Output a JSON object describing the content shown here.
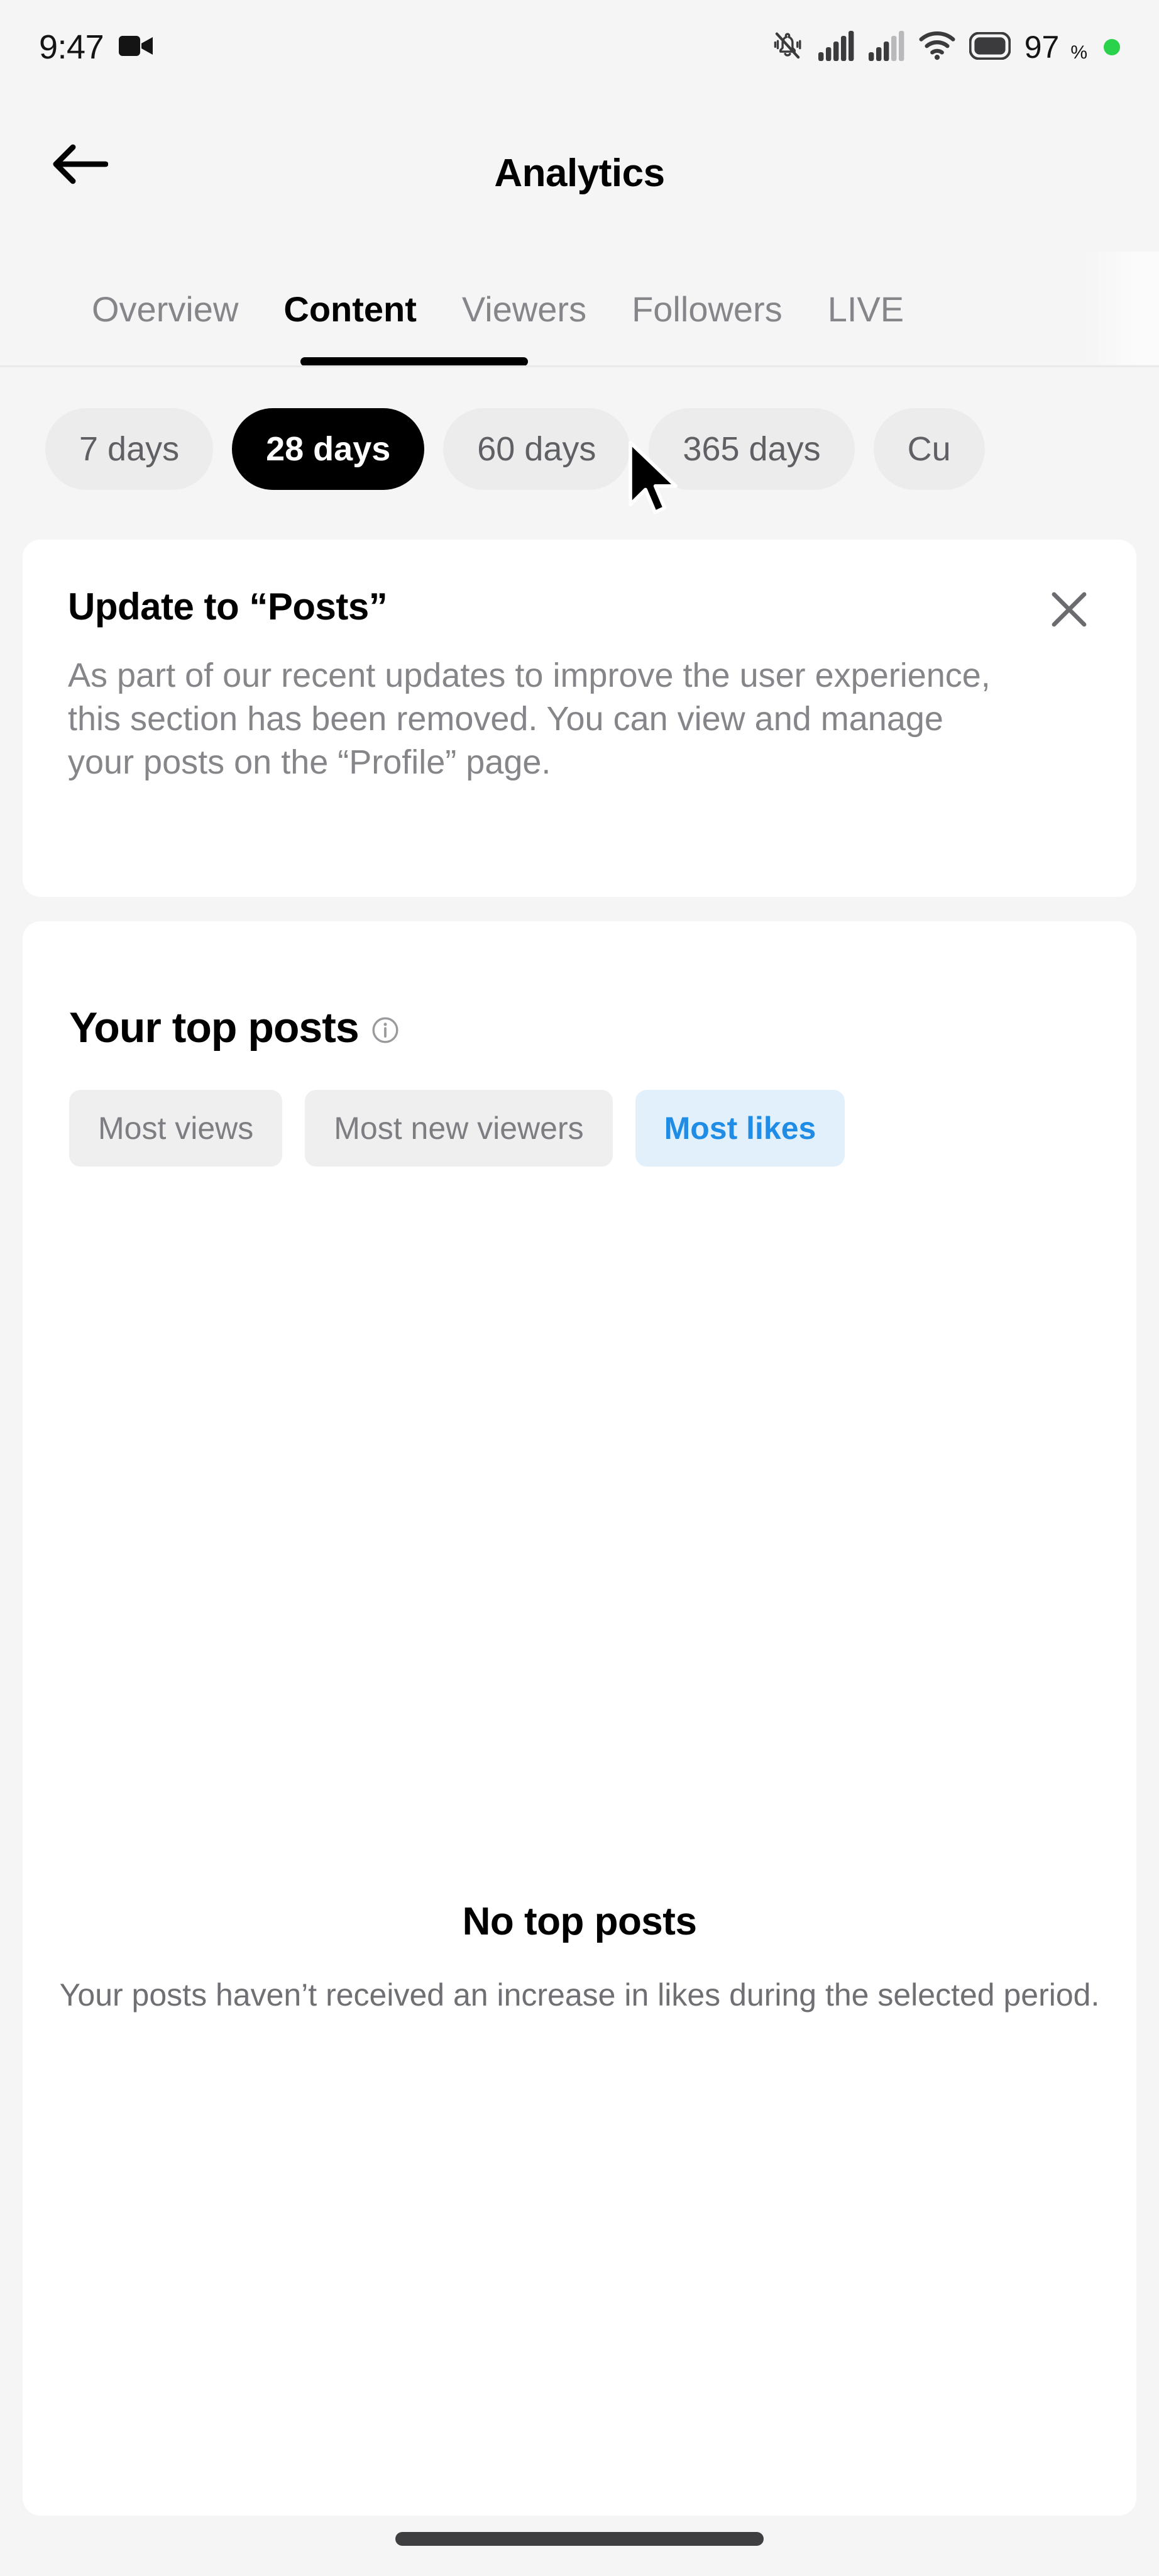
{
  "status_bar": {
    "time": "9:47",
    "camera_icon": "video-camera-icon",
    "mute_icon": "bell-muted-icon",
    "signal_icon_1": "cellular-signal-icon",
    "signal_icon_2": "cellular-signal-icon",
    "wifi_icon": "wifi-icon",
    "battery_icon": "battery-icon",
    "battery_percent": "97",
    "battery_symbol": "%",
    "recording_dot": "green-status-dot"
  },
  "header": {
    "back_icon": "arrow-left-icon",
    "title": "Analytics"
  },
  "tabs": {
    "items": [
      {
        "label": "Overview",
        "active": false
      },
      {
        "label": "Content",
        "active": true
      },
      {
        "label": "Viewers",
        "active": false
      },
      {
        "label": "Followers",
        "active": false
      },
      {
        "label": "LIVE",
        "active": false
      }
    ]
  },
  "date_range": {
    "chips": [
      {
        "label": "7 days",
        "selected": false
      },
      {
        "label": "28 days",
        "selected": true
      },
      {
        "label": "60 days",
        "selected": false
      },
      {
        "label": "365 days",
        "selected": false
      },
      {
        "label": "Cu",
        "selected": false
      }
    ]
  },
  "notice": {
    "title": "Update to “Posts”",
    "body": "As part of our recent updates to improve the user experience, this section has been removed. You can view and manage your posts on the “Profile” page.",
    "close_icon": "close-icon"
  },
  "top_posts": {
    "title": "Your top posts",
    "info_icon": "info-circle-icon",
    "filters": [
      {
        "label": "Most views",
        "selected": false
      },
      {
        "label": "Most new viewers",
        "selected": false
      },
      {
        "label": "Most likes",
        "selected": true
      }
    ],
    "empty_state": {
      "title": "No top posts",
      "subtitle": "Your posts haven’t received an increase in likes during the selected period."
    }
  },
  "system": {
    "home_indicator": "home-indicator",
    "cursor": "mouse-pointer"
  },
  "colors": {
    "background": "#f5f5f6",
    "card": "#ffffff",
    "accent_blue": "#1f8ce6",
    "accent_blue_bg": "#e2f0fb",
    "selected_chip": "#000000",
    "muted_text": "#86868a",
    "battery_dot_green": "#2ad14b"
  }
}
